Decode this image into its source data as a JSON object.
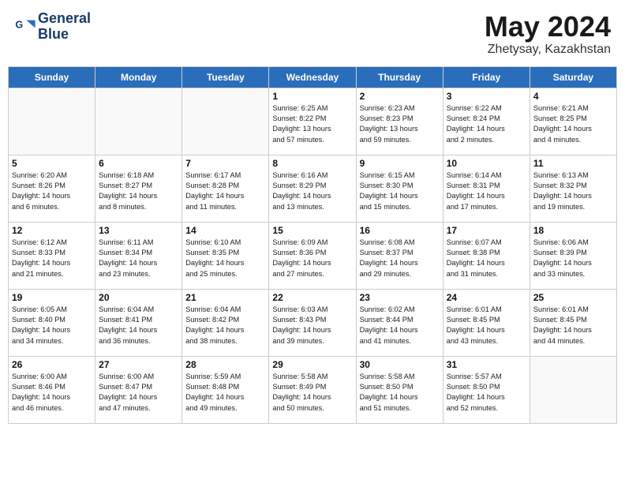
{
  "header": {
    "logo_line1": "General",
    "logo_line2": "Blue",
    "month_title": "May 2024",
    "location": "Zhetysay, Kazakhstan"
  },
  "weekdays": [
    "Sunday",
    "Monday",
    "Tuesday",
    "Wednesday",
    "Thursday",
    "Friday",
    "Saturday"
  ],
  "weeks": [
    [
      {
        "day": "",
        "info": ""
      },
      {
        "day": "",
        "info": ""
      },
      {
        "day": "",
        "info": ""
      },
      {
        "day": "1",
        "info": "Sunrise: 6:25 AM\nSunset: 8:22 PM\nDaylight: 13 hours\nand 57 minutes."
      },
      {
        "day": "2",
        "info": "Sunrise: 6:23 AM\nSunset: 8:23 PM\nDaylight: 13 hours\nand 59 minutes."
      },
      {
        "day": "3",
        "info": "Sunrise: 6:22 AM\nSunset: 8:24 PM\nDaylight: 14 hours\nand 2 minutes."
      },
      {
        "day": "4",
        "info": "Sunrise: 6:21 AM\nSunset: 8:25 PM\nDaylight: 14 hours\nand 4 minutes."
      }
    ],
    [
      {
        "day": "5",
        "info": "Sunrise: 6:20 AM\nSunset: 8:26 PM\nDaylight: 14 hours\nand 6 minutes."
      },
      {
        "day": "6",
        "info": "Sunrise: 6:18 AM\nSunset: 8:27 PM\nDaylight: 14 hours\nand 8 minutes."
      },
      {
        "day": "7",
        "info": "Sunrise: 6:17 AM\nSunset: 8:28 PM\nDaylight: 14 hours\nand 11 minutes."
      },
      {
        "day": "8",
        "info": "Sunrise: 6:16 AM\nSunset: 8:29 PM\nDaylight: 14 hours\nand 13 minutes."
      },
      {
        "day": "9",
        "info": "Sunrise: 6:15 AM\nSunset: 8:30 PM\nDaylight: 14 hours\nand 15 minutes."
      },
      {
        "day": "10",
        "info": "Sunrise: 6:14 AM\nSunset: 8:31 PM\nDaylight: 14 hours\nand 17 minutes."
      },
      {
        "day": "11",
        "info": "Sunrise: 6:13 AM\nSunset: 8:32 PM\nDaylight: 14 hours\nand 19 minutes."
      }
    ],
    [
      {
        "day": "12",
        "info": "Sunrise: 6:12 AM\nSunset: 8:33 PM\nDaylight: 14 hours\nand 21 minutes."
      },
      {
        "day": "13",
        "info": "Sunrise: 6:11 AM\nSunset: 8:34 PM\nDaylight: 14 hours\nand 23 minutes."
      },
      {
        "day": "14",
        "info": "Sunrise: 6:10 AM\nSunset: 8:35 PM\nDaylight: 14 hours\nand 25 minutes."
      },
      {
        "day": "15",
        "info": "Sunrise: 6:09 AM\nSunset: 8:36 PM\nDaylight: 14 hours\nand 27 minutes."
      },
      {
        "day": "16",
        "info": "Sunrise: 6:08 AM\nSunset: 8:37 PM\nDaylight: 14 hours\nand 29 minutes."
      },
      {
        "day": "17",
        "info": "Sunrise: 6:07 AM\nSunset: 8:38 PM\nDaylight: 14 hours\nand 31 minutes."
      },
      {
        "day": "18",
        "info": "Sunrise: 6:06 AM\nSunset: 8:39 PM\nDaylight: 14 hours\nand 33 minutes."
      }
    ],
    [
      {
        "day": "19",
        "info": "Sunrise: 6:05 AM\nSunset: 8:40 PM\nDaylight: 14 hours\nand 34 minutes."
      },
      {
        "day": "20",
        "info": "Sunrise: 6:04 AM\nSunset: 8:41 PM\nDaylight: 14 hours\nand 36 minutes."
      },
      {
        "day": "21",
        "info": "Sunrise: 6:04 AM\nSunset: 8:42 PM\nDaylight: 14 hours\nand 38 minutes."
      },
      {
        "day": "22",
        "info": "Sunrise: 6:03 AM\nSunset: 8:43 PM\nDaylight: 14 hours\nand 39 minutes."
      },
      {
        "day": "23",
        "info": "Sunrise: 6:02 AM\nSunset: 8:44 PM\nDaylight: 14 hours\nand 41 minutes."
      },
      {
        "day": "24",
        "info": "Sunrise: 6:01 AM\nSunset: 8:45 PM\nDaylight: 14 hours\nand 43 minutes."
      },
      {
        "day": "25",
        "info": "Sunrise: 6:01 AM\nSunset: 8:45 PM\nDaylight: 14 hours\nand 44 minutes."
      }
    ],
    [
      {
        "day": "26",
        "info": "Sunrise: 6:00 AM\nSunset: 8:46 PM\nDaylight: 14 hours\nand 46 minutes."
      },
      {
        "day": "27",
        "info": "Sunrise: 6:00 AM\nSunset: 8:47 PM\nDaylight: 14 hours\nand 47 minutes."
      },
      {
        "day": "28",
        "info": "Sunrise: 5:59 AM\nSunset: 8:48 PM\nDaylight: 14 hours\nand 49 minutes."
      },
      {
        "day": "29",
        "info": "Sunrise: 5:58 AM\nSunset: 8:49 PM\nDaylight: 14 hours\nand 50 minutes."
      },
      {
        "day": "30",
        "info": "Sunrise: 5:58 AM\nSunset: 8:50 PM\nDaylight: 14 hours\nand 51 minutes."
      },
      {
        "day": "31",
        "info": "Sunrise: 5:57 AM\nSunset: 8:50 PM\nDaylight: 14 hours\nand 52 minutes."
      },
      {
        "day": "",
        "info": ""
      }
    ]
  ]
}
